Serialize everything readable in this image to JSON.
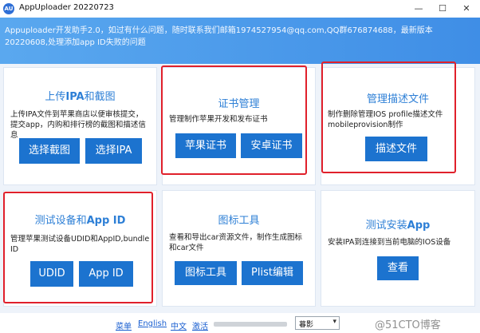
{
  "window": {
    "title": "AppUploader 20220723",
    "icon_text": "AU",
    "controls": {
      "minimize": "—",
      "maximize": "☐",
      "close": "✕"
    }
  },
  "banner": {
    "text": "Appuploader开发助手2.0，如过有什么问题，随时联系我们邮箱1974527954@qq.com,QQ群676874688，最新版本20220608,处理添加app ID失败的问题"
  },
  "cards": {
    "upload": {
      "title_pre": "上传",
      "title_bold": "IPA",
      "title_post": "和截图",
      "desc": "上传IPA文件到苹果商店以便审核提交，提交app，内购和排行榜的截图和描述信息",
      "buttons": [
        "选择截图",
        "选择IPA"
      ]
    },
    "cert": {
      "title": "证书管理",
      "desc": "管理制作苹果开发和发布证书",
      "buttons": [
        "苹果证书",
        "安卓证书"
      ]
    },
    "profile": {
      "title": "管理描述文件",
      "desc": "制作删除管理IOS profile描述文件mobileprovision制作",
      "buttons": [
        "描述文件"
      ]
    },
    "device": {
      "title_pre": "测试设备和",
      "title_bold": "App ID",
      "desc": "管理苹果测试设备UDID和AppID,bundle ID",
      "buttons": [
        "UDID",
        "App ID"
      ]
    },
    "icon": {
      "title": "图标工具",
      "desc": "查看和导出car资源文件，制作生成图标和car文件",
      "buttons": [
        "图标工具",
        "Plist编辑"
      ]
    },
    "install": {
      "title_pre": "测试安装",
      "title_bold": "App",
      "desc": "安装IPA到连接到当前电脑的IOS设备",
      "buttons": [
        "查看"
      ]
    }
  },
  "footer": {
    "links": [
      "菜单",
      "English",
      "中文",
      "激活"
    ],
    "select_value": "暮影",
    "watermark": "@51CTO博客"
  },
  "colors": {
    "accent": "#1c73cf",
    "title_blue": "#2d7fd6",
    "highlight": "#e0202b",
    "banner": "#4a9ae9"
  }
}
